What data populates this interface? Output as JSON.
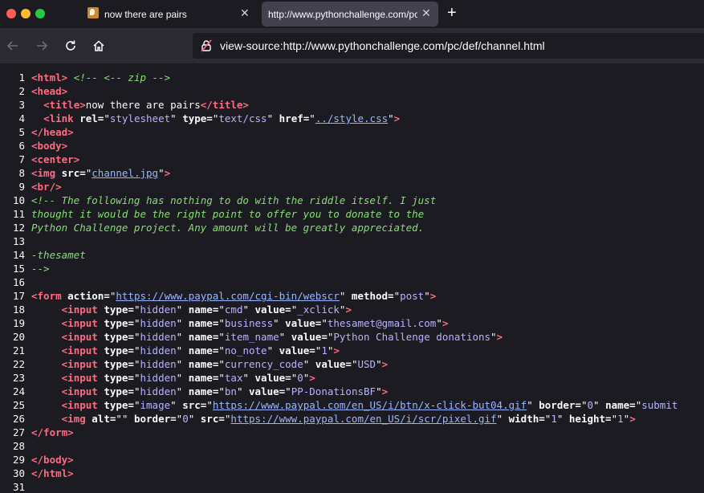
{
  "window_controls": {
    "close_color": "#ff5f57",
    "minimize_color": "#febc2e",
    "maximize_color": "#28c840"
  },
  "tabs": [
    {
      "title": "now there are pairs",
      "active": false
    },
    {
      "title": "http://www.pythonchallenge.com/pc/def/channel.html",
      "active": true
    }
  ],
  "new_tab_label": "+",
  "address_bar": {
    "url": "view-source:http://www.pythonchallenge.com/pc/def/channel.html"
  },
  "source_lines": [
    [
      [
        "tag",
        "<html>"
      ],
      [
        "txt",
        " "
      ],
      [
        "cm",
        "<!-- <-- zip -->"
      ]
    ],
    [
      [
        "tag",
        "<head>"
      ]
    ],
    [
      [
        "txt",
        "  "
      ],
      [
        "tag",
        "<title>"
      ],
      [
        "txt",
        "now there are pairs"
      ],
      [
        "tag",
        "</title>"
      ]
    ],
    [
      [
        "txt",
        "  "
      ],
      [
        "tag",
        "<link "
      ],
      [
        "attr",
        "rel="
      ],
      [
        "txt",
        "\""
      ],
      [
        "val",
        "stylesheet"
      ],
      [
        "txt",
        "\" "
      ],
      [
        "attr",
        "type="
      ],
      [
        "txt",
        "\""
      ],
      [
        "val",
        "text/css"
      ],
      [
        "txt",
        "\" "
      ],
      [
        "attr",
        "href="
      ],
      [
        "txt",
        "\""
      ],
      [
        "lnk",
        "../style.css"
      ],
      [
        "txt",
        "\""
      ],
      [
        "tag",
        ">"
      ]
    ],
    [
      [
        "tag",
        "</head>"
      ]
    ],
    [
      [
        "tag",
        "<body>"
      ]
    ],
    [
      [
        "tag",
        "<center>"
      ]
    ],
    [
      [
        "tag",
        "<img "
      ],
      [
        "attr",
        "src="
      ],
      [
        "txt",
        "\""
      ],
      [
        "lnk",
        "channel.jpg"
      ],
      [
        "txt",
        "\""
      ],
      [
        "tag",
        ">"
      ]
    ],
    [
      [
        "tag",
        "<br/>"
      ]
    ],
    [
      [
        "cm",
        "<!-- The following has nothing to do with the riddle itself. I just"
      ]
    ],
    [
      [
        "cm",
        "thought it would be the right point to offer you to donate to the"
      ]
    ],
    [
      [
        "cm",
        "Python Challenge project. Any amount will be greatly appreciated."
      ]
    ],
    [],
    [
      [
        "cm",
        "-thesamet"
      ]
    ],
    [
      [
        "cm",
        "-->"
      ]
    ],
    [],
    [
      [
        "tag",
        "<form "
      ],
      [
        "attr",
        "action="
      ],
      [
        "txt",
        "\""
      ],
      [
        "lnk",
        "https://www.paypal.com/cgi-bin/webscr"
      ],
      [
        "txt",
        "\" "
      ],
      [
        "attr",
        "method="
      ],
      [
        "txt",
        "\""
      ],
      [
        "val",
        "post"
      ],
      [
        "txt",
        "\""
      ],
      [
        "tag",
        ">"
      ]
    ],
    [
      [
        "txt",
        "     "
      ],
      [
        "tag",
        "<input "
      ],
      [
        "attr",
        "type="
      ],
      [
        "txt",
        "\""
      ],
      [
        "val",
        "hidden"
      ],
      [
        "txt",
        "\" "
      ],
      [
        "attr",
        "name="
      ],
      [
        "txt",
        "\""
      ],
      [
        "val",
        "cmd"
      ],
      [
        "txt",
        "\" "
      ],
      [
        "attr",
        "value="
      ],
      [
        "txt",
        "\""
      ],
      [
        "val",
        "_xclick"
      ],
      [
        "txt",
        "\""
      ],
      [
        "tag",
        ">"
      ]
    ],
    [
      [
        "txt",
        "     "
      ],
      [
        "tag",
        "<input "
      ],
      [
        "attr",
        "type="
      ],
      [
        "txt",
        "\""
      ],
      [
        "val",
        "hidden"
      ],
      [
        "txt",
        "\" "
      ],
      [
        "attr",
        "name="
      ],
      [
        "txt",
        "\""
      ],
      [
        "val",
        "business"
      ],
      [
        "txt",
        "\" "
      ],
      [
        "attr",
        "value="
      ],
      [
        "txt",
        "\""
      ],
      [
        "val",
        "thesamet@gmail.com"
      ],
      [
        "txt",
        "\""
      ],
      [
        "tag",
        ">"
      ]
    ],
    [
      [
        "txt",
        "     "
      ],
      [
        "tag",
        "<input "
      ],
      [
        "attr",
        "type="
      ],
      [
        "txt",
        "\""
      ],
      [
        "val",
        "hidden"
      ],
      [
        "txt",
        "\" "
      ],
      [
        "attr",
        "name="
      ],
      [
        "txt",
        "\""
      ],
      [
        "val",
        "item_name"
      ],
      [
        "txt",
        "\" "
      ],
      [
        "attr",
        "value="
      ],
      [
        "txt",
        "\""
      ],
      [
        "val",
        "Python Challenge donations"
      ],
      [
        "txt",
        "\""
      ],
      [
        "tag",
        ">"
      ]
    ],
    [
      [
        "txt",
        "     "
      ],
      [
        "tag",
        "<input "
      ],
      [
        "attr",
        "type="
      ],
      [
        "txt",
        "\""
      ],
      [
        "val",
        "hidden"
      ],
      [
        "txt",
        "\" "
      ],
      [
        "attr",
        "name="
      ],
      [
        "txt",
        "\""
      ],
      [
        "val",
        "no_note"
      ],
      [
        "txt",
        "\" "
      ],
      [
        "attr",
        "value="
      ],
      [
        "txt",
        "\""
      ],
      [
        "val",
        "1"
      ],
      [
        "txt",
        "\""
      ],
      [
        "tag",
        ">"
      ]
    ],
    [
      [
        "txt",
        "     "
      ],
      [
        "tag",
        "<input "
      ],
      [
        "attr",
        "type="
      ],
      [
        "txt",
        "\""
      ],
      [
        "val",
        "hidden"
      ],
      [
        "txt",
        "\" "
      ],
      [
        "attr",
        "name="
      ],
      [
        "txt",
        "\""
      ],
      [
        "val",
        "currency_code"
      ],
      [
        "txt",
        "\" "
      ],
      [
        "attr",
        "value="
      ],
      [
        "txt",
        "\""
      ],
      [
        "val",
        "USD"
      ],
      [
        "txt",
        "\""
      ],
      [
        "tag",
        ">"
      ]
    ],
    [
      [
        "txt",
        "     "
      ],
      [
        "tag",
        "<input "
      ],
      [
        "attr",
        "type="
      ],
      [
        "txt",
        "\""
      ],
      [
        "val",
        "hidden"
      ],
      [
        "txt",
        "\" "
      ],
      [
        "attr",
        "name="
      ],
      [
        "txt",
        "\""
      ],
      [
        "val",
        "tax"
      ],
      [
        "txt",
        "\" "
      ],
      [
        "attr",
        "value="
      ],
      [
        "txt",
        "\""
      ],
      [
        "val",
        "0"
      ],
      [
        "txt",
        "\""
      ],
      [
        "tag",
        ">"
      ]
    ],
    [
      [
        "txt",
        "     "
      ],
      [
        "tag",
        "<input "
      ],
      [
        "attr",
        "type="
      ],
      [
        "txt",
        "\""
      ],
      [
        "val",
        "hidden"
      ],
      [
        "txt",
        "\" "
      ],
      [
        "attr",
        "name="
      ],
      [
        "txt",
        "\""
      ],
      [
        "val",
        "bn"
      ],
      [
        "txt",
        "\" "
      ],
      [
        "attr",
        "value="
      ],
      [
        "txt",
        "\""
      ],
      [
        "val",
        "PP-DonationsBF"
      ],
      [
        "txt",
        "\""
      ],
      [
        "tag",
        ">"
      ]
    ],
    [
      [
        "txt",
        "     "
      ],
      [
        "tag",
        "<input "
      ],
      [
        "attr",
        "type="
      ],
      [
        "txt",
        "\""
      ],
      [
        "val",
        "image"
      ],
      [
        "txt",
        "\" "
      ],
      [
        "attr",
        "src="
      ],
      [
        "txt",
        "\""
      ],
      [
        "lnk",
        "https://www.paypal.com/en_US/i/btn/x-click-but04.gif"
      ],
      [
        "txt",
        "\" "
      ],
      [
        "attr",
        "border="
      ],
      [
        "txt",
        "\""
      ],
      [
        "val",
        "0"
      ],
      [
        "txt",
        "\" "
      ],
      [
        "attr",
        "name="
      ],
      [
        "txt",
        "\""
      ],
      [
        "val",
        "submit"
      ]
    ],
    [
      [
        "txt",
        "     "
      ],
      [
        "tag",
        "<img "
      ],
      [
        "attr",
        "alt="
      ],
      [
        "txt",
        "\"\" "
      ],
      [
        "attr",
        "border="
      ],
      [
        "txt",
        "\""
      ],
      [
        "val",
        "0"
      ],
      [
        "txt",
        "\" "
      ],
      [
        "attr",
        "src="
      ],
      [
        "txt",
        "\""
      ],
      [
        "lnk",
        "https://www.paypal.com/en_US/i/scr/pixel.gif"
      ],
      [
        "txt",
        "\" "
      ],
      [
        "attr",
        "width="
      ],
      [
        "txt",
        "\""
      ],
      [
        "val",
        "1"
      ],
      [
        "txt",
        "\" "
      ],
      [
        "attr",
        "height="
      ],
      [
        "txt",
        "\""
      ],
      [
        "val",
        "1"
      ],
      [
        "txt",
        "\""
      ],
      [
        "tag",
        ">"
      ]
    ],
    [
      [
        "tag",
        "</form>"
      ]
    ],
    [],
    [
      [
        "tag",
        "</body>"
      ]
    ],
    [
      [
        "tag",
        "</html>"
      ]
    ],
    []
  ]
}
